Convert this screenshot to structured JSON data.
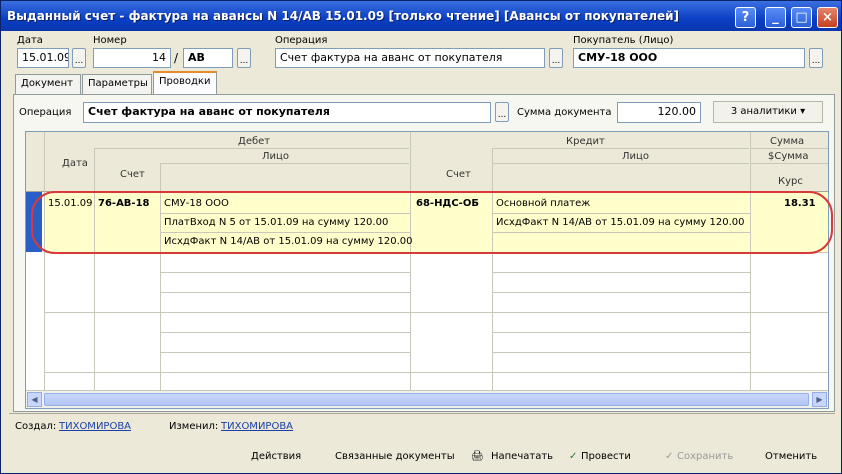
{
  "window": {
    "title": "Выданный счет - фактура на авансы N 14/АВ 15.01.09 [только чтение] [Авансы от покупателей]",
    "help_label": "?",
    "min_label": "_",
    "max_label": "□",
    "close_label": "×"
  },
  "header": {
    "date_label": "Дата",
    "date_value": "15.01.09",
    "number_label": "Номер",
    "number_value": "14",
    "number_slash": "/",
    "number_suffix": "АВ",
    "operation_label": "Операция",
    "operation_value": "Счет фактура на аванс от покупателя",
    "buyer_label": "Покупатель (Лицо)",
    "buyer_value": "СМУ-18 ООО"
  },
  "tabs": [
    {
      "label": "Документ"
    },
    {
      "label": "Параметры"
    },
    {
      "label": "Проводки"
    }
  ],
  "entries_panel": {
    "operation_label": "Операция",
    "operation_value": "Счет фактура на аванс от покупателя",
    "doc_sum_label": "Сумма документа",
    "doc_sum_value": "120.00",
    "analytics_button": "3 аналитики ▾"
  },
  "grid": {
    "headers": {
      "date": "Дата",
      "debit": "Дебет",
      "debit_account": "Счет",
      "debit_person": "Лицо",
      "credit": "Кредит",
      "credit_account": "Счет",
      "credit_person": "Лицо",
      "sum": "Сумма",
      "sum_currency": "$Сумма",
      "rate": "Курс"
    },
    "row": {
      "date": "15.01.09",
      "debit_account": "76-АВ-18",
      "debit_lines": [
        "СМУ-18 ООО",
        "ПлатВход N 5 от 15.01.09 на сумму 120.00",
        "ИсхдФакт N 14/АВ от 15.01.09 на сумму 120.00"
      ],
      "credit_account": "68-НДС-ОБ",
      "credit_lines": [
        "Основной платеж",
        "ИсхдФакт N 14/АВ от 15.01.09 на сумму 120.00"
      ],
      "sum": "18.31"
    }
  },
  "footer": {
    "created_label": "Создал:",
    "created_by": "ТИХОМИРОВА",
    "changed_label": "Изменил:",
    "changed_by": "ТИХОМИРОВА",
    "buttons": {
      "actions": "Действия",
      "linked_docs": "Связанные документы",
      "print": "Напечатать",
      "post": "Провести",
      "save": "Сохранить",
      "cancel": "Отменить"
    }
  },
  "colors": {
    "titlebar": "#0a3fc4",
    "highlight": "#ffffcc",
    "annotation": "#d83a3a",
    "link": "#1a3fa8"
  }
}
